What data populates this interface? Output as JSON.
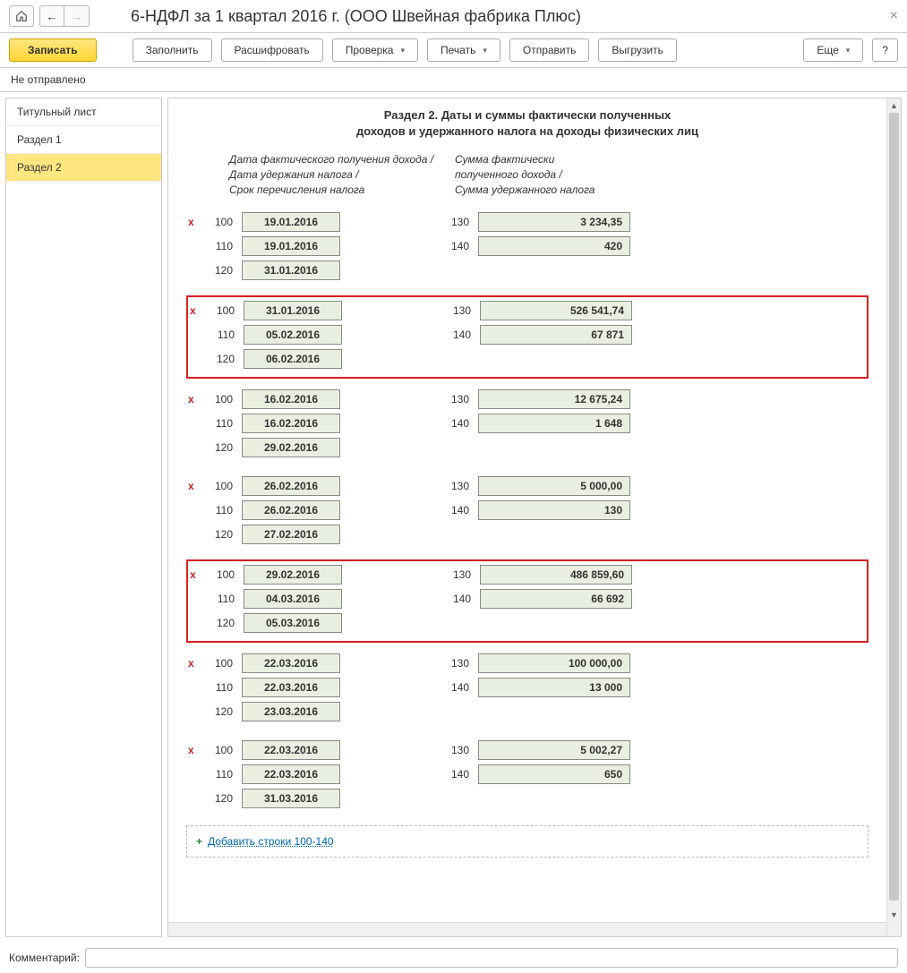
{
  "header": {
    "title": "6-НДФЛ за 1 квартал 2016 г. (ООО Швейная фабрика Плюс)"
  },
  "toolbar": {
    "save": "Записать",
    "fill": "Заполнить",
    "decode": "Расшифровать",
    "check": "Проверка",
    "print": "Печать",
    "send": "Отправить",
    "export": "Выгрузить",
    "more": "Еще",
    "help": "?"
  },
  "status": "Не отправлено",
  "tabs": [
    {
      "label": "Титульный лист",
      "active": false
    },
    {
      "label": "Раздел 1",
      "active": false
    },
    {
      "label": "Раздел 2",
      "active": true
    }
  ],
  "section": {
    "title_line1": "Раздел 2.  Даты и суммы фактически полученных",
    "title_line2": "доходов и удержанного налога на доходы физических лиц",
    "header_left": "Дата фактического получения дохода /\nДата удержания налога /\nСрок перечисления налога",
    "header_right": "Сумма фактически\nполученного дохода /\nСумма удержанного налога"
  },
  "codes": {
    "c100": "100",
    "c110": "110",
    "c120": "120",
    "c130": "130",
    "c140": "140"
  },
  "blocks": [
    {
      "highlighted": false,
      "d100": "19.01.2016",
      "d110": "19.01.2016",
      "d120": "31.01.2016",
      "s130": "3 234,35",
      "s140": "420"
    },
    {
      "highlighted": true,
      "d100": "31.01.2016",
      "d110": "05.02.2016",
      "d120": "06.02.2016",
      "s130": "526 541,74",
      "s140": "67 871"
    },
    {
      "highlighted": false,
      "d100": "16.02.2016",
      "d110": "16.02.2016",
      "d120": "29.02.2016",
      "s130": "12 675,24",
      "s140": "1 648"
    },
    {
      "highlighted": false,
      "d100": "26.02.2016",
      "d110": "26.02.2016",
      "d120": "27.02.2016",
      "s130": "5 000,00",
      "s140": "130"
    },
    {
      "highlighted": true,
      "d100": "29.02.2016",
      "d110": "04.03.2016",
      "d120": "05.03.2016",
      "s130": "486 859,60",
      "s140": "66 692"
    },
    {
      "highlighted": false,
      "d100": "22.03.2016",
      "d110": "22.03.2016",
      "d120": "23.03.2016",
      "s130": "100 000,00",
      "s140": "13 000"
    },
    {
      "highlighted": false,
      "d100": "22.03.2016",
      "d110": "22.03.2016",
      "d120": "31.03.2016",
      "s130": "5 002,27",
      "s140": "650"
    }
  ],
  "add_link": "Добавить строки 100-140",
  "footer": {
    "comment_label": "Комментарий:"
  }
}
